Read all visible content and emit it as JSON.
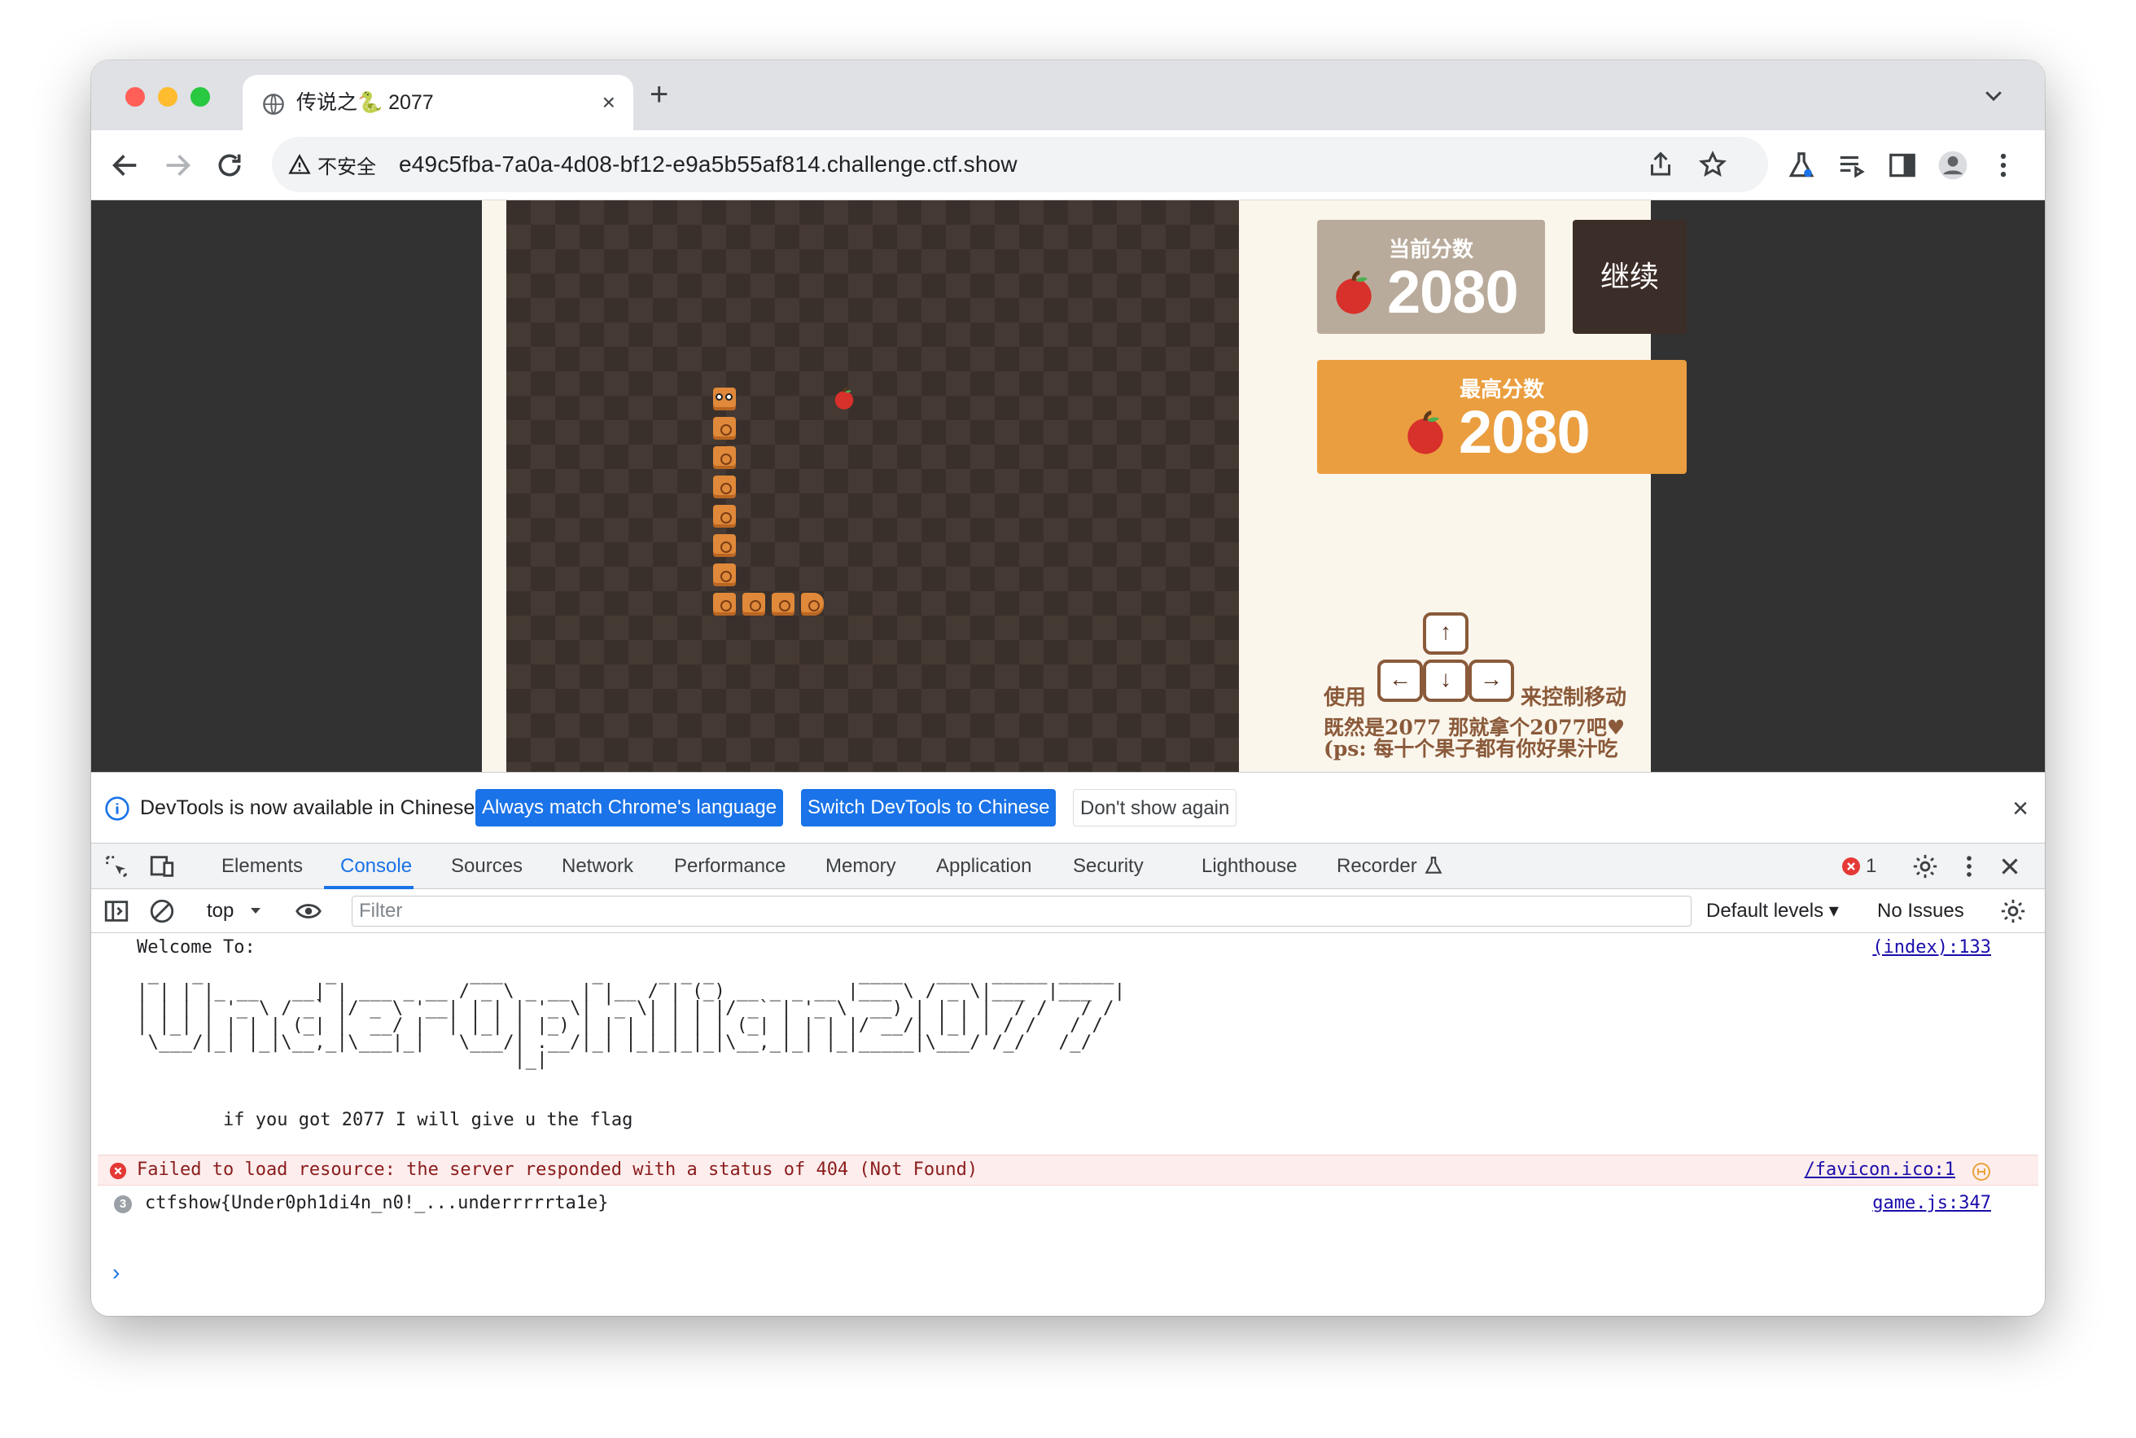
{
  "browser": {
    "tab_title": "传说之🐍 2077",
    "tab_close": "×",
    "new_tab": "+",
    "security_label": "不安全",
    "url": "e49c5fba-7a0a-4d08-bf12-e9a5b55af814.challenge.ctf.show"
  },
  "game": {
    "current_score_label": "当前分数",
    "current_score": "2080",
    "continue_label": "继续",
    "best_score_label": "最高分数",
    "best_score": "2080",
    "hint_use": "使用",
    "hint_control": "来控制移动",
    "hint_line2": "既然是2077 那就拿个2077吧♥",
    "hint_line3": "(ps: 每十个果子都有你好果汁吃",
    "key_up": "↑",
    "key_left": "←",
    "key_down": "↓",
    "key_right": "→"
  },
  "infobar": {
    "text": "DevTools is now available in Chinese!",
    "btn_match": "Always match Chrome's language",
    "btn_switch": "Switch DevTools to Chinese",
    "btn_dont_show": "Don't show again",
    "close": "×"
  },
  "devtools": {
    "tabs": [
      "Elements",
      "Console",
      "Sources",
      "Network",
      "Performance",
      "Memory",
      "Application",
      "Security",
      "Lighthouse",
      "Recorder"
    ],
    "active_tab": "Console",
    "error_count": "1",
    "context": "top",
    "filter_placeholder": "Filter",
    "levels": "Default levels ▾",
    "issues": "No Issues"
  },
  "console": {
    "welcome": "Welcome To:",
    "welcome_src": "(index):133",
    "ascii_art": " _   _           _            ___        _     _ _ _             ____   ___  _____ _____ \n| | | |_ __   __| | ___ _ __ / _ \\ _ __ | |__ / | (_) __ _ _ __ |___ \\ / _ \\|___  |___  |\n| | | | '_ \\ / _` |/ _ \\ '__| | | | '_ \\| '_ \\| | | |/ _` | '_ \\  __) | | | |  / /   / / \n| |_| | | | | (_| |  __/ |  | |_| | |_) | | | | | | | (_| | | | |/ __/| |_| | / /   / /  \n \\___/|_| |_|\\__,_|\\___|_|   \\___/| .__/|_| |_|_|_|_|\\__,_|_| |_|_____|\\___/ /_/   /_/   \n                                  |_|                                                     ",
    "subtitle": "if you got 2077 I will give u the flag",
    "error": "Failed to load resource: the server responded with a status of 404 (Not Found)",
    "error_src": "/favicon.ico:1",
    "repeat_count": "3",
    "flag": "ctfshow{Under0ph1di4n_n0!_...underrrrrta1e}",
    "flag_src": "game.js:347",
    "prompt": "›"
  }
}
